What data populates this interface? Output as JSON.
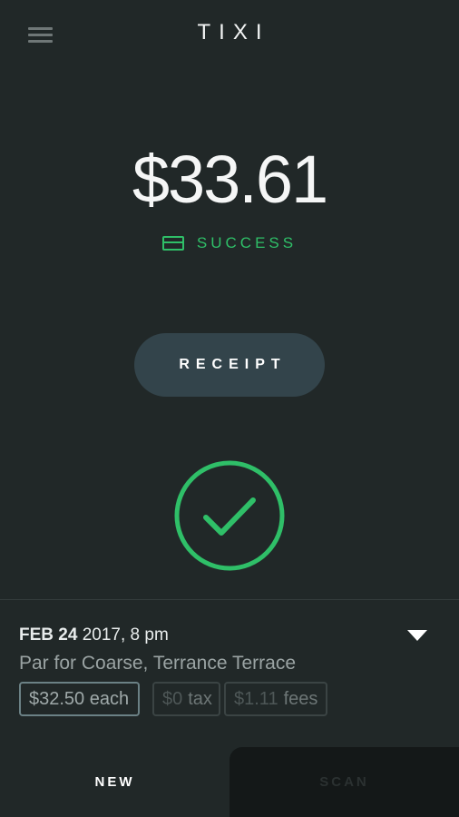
{
  "header": {
    "logo": "TIXI"
  },
  "payment": {
    "amount": "$33.61",
    "status": "SUCCESS",
    "receipt_label": "RECEIPT"
  },
  "details": {
    "date_bold": "FEB 24",
    "date_rest": "2017, 8 pm",
    "venue": "Par for Coarse, Terrance Terrace",
    "price_each": "$32.50 each",
    "tax_amount": "$0",
    "tax_label": "tax",
    "fees_amount": "$1.11",
    "fees_label": "fees"
  },
  "tabs": {
    "new": "NEW",
    "scan": "SCAN"
  },
  "colors": {
    "background": "#212828",
    "success": "#2fbf68",
    "button": "#33444b"
  },
  "icons": {
    "menu": "hamburger-menu-icon",
    "status": "credit-card-icon",
    "check": "checkmark-circle-icon",
    "expand": "triangle-down-icon"
  }
}
